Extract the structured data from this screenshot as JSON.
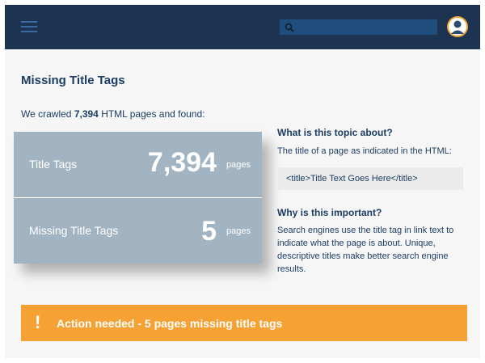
{
  "header": {
    "search": {
      "placeholder": "",
      "icon": "search-icon"
    },
    "menu_icon": "hamburger-menu-icon",
    "avatar_icon": "user-avatar"
  },
  "page": {
    "title": "Missing Title Tags",
    "crawl_prefix": "We crawled",
    "crawl_count": "7,394",
    "crawl_suffix": "HTML pages and found:"
  },
  "stats": [
    {
      "label": "Title Tags",
      "value": "7,394",
      "unit": "pages"
    },
    {
      "label": "Missing Title Tags",
      "value": "5",
      "unit": "pages"
    }
  ],
  "info": {
    "q1": "What is this topic about?",
    "a1": "The title of a page as indicated in the HTML:",
    "code": "<title>Title Text Goes Here</title>",
    "q2": "Why is this important?",
    "a2": "Search engines use the title tag in link text to indicate what the page is about. Unique, descriptive titles make better search engine results."
  },
  "alert": {
    "icon": "!",
    "message": "Action needed - 5 pages missing title tags"
  },
  "colors": {
    "topbar": "#1c3351",
    "search_bg": "#1f4d7c",
    "stat_card": "#a2b4c1",
    "text_navy": "#1c3d63",
    "alert_orange": "#f6a133",
    "avatar_bg": "#f0a537"
  }
}
